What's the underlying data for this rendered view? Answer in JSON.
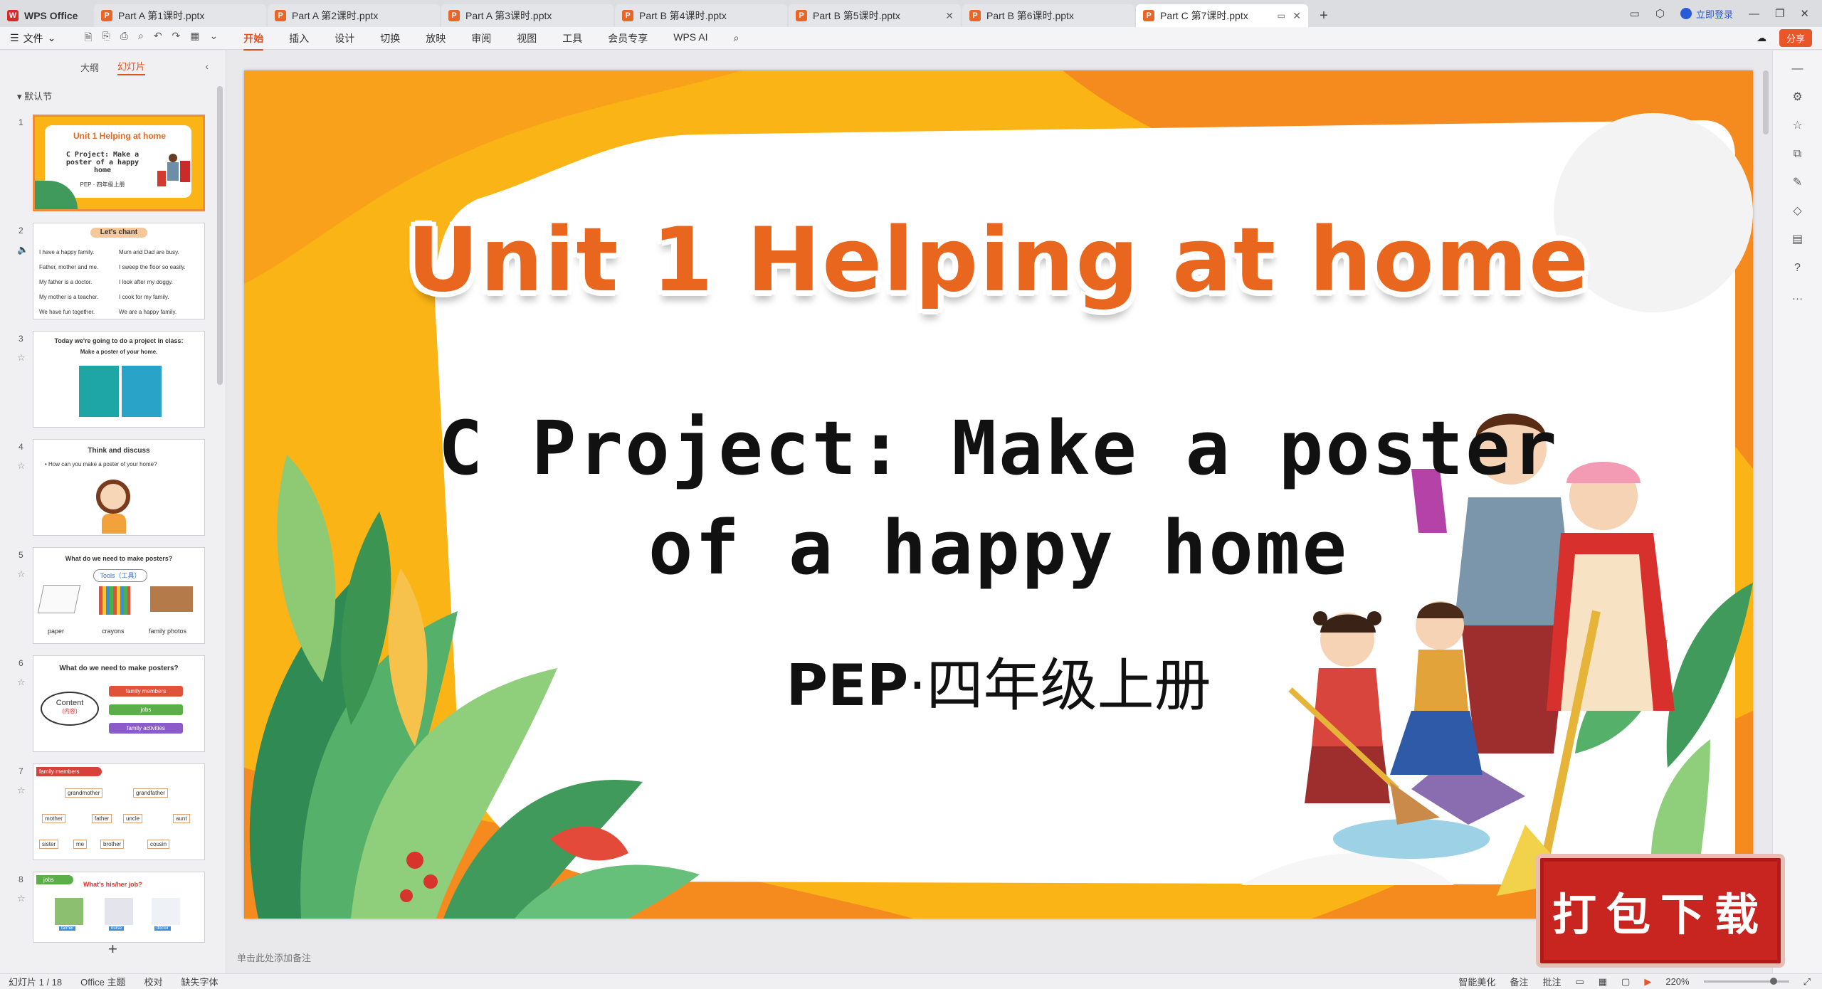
{
  "tabs": [
    {
      "label": "WPS Office",
      "home": true
    },
    {
      "label": "Part A 第1课时.pptx"
    },
    {
      "label": "Part A 第2课时.pptx"
    },
    {
      "label": "Part A 第3课时.pptx"
    },
    {
      "label": "Part B 第4课时.pptx"
    },
    {
      "label": "Part B 第5课时.pptx",
      "closable": true
    },
    {
      "label": "Part B 第6课时.pptx"
    },
    {
      "label": "Part C 第7课时.pptx",
      "active": true,
      "closable": true
    }
  ],
  "window": {
    "login": "立即登录"
  },
  "menubar": {
    "file": "文件",
    "items": [
      "开始",
      "插入",
      "设计",
      "切换",
      "放映",
      "审阅",
      "视图",
      "工具",
      "会员专享",
      "WPS AI"
    ],
    "active": "开始",
    "share": "分享"
  },
  "left_panel": {
    "tab_outline": "大纲",
    "tab_slides": "幻灯片",
    "section": "默认节",
    "slides": [
      {
        "num": "1",
        "title": "Unit 1 Helping at home",
        "sub": "C Project: Make a poster of a happy home",
        "foot": "PEP · 四年级上册"
      },
      {
        "num": "2",
        "title": "Let's chant",
        "lines": [
          "I have a happy family.",
          "Mum and Dad are busy.",
          "Father, mother and me.",
          "I sweep the floor so easily.",
          "My father is a doctor.",
          "I look after my doggy.",
          "My mother is a teacher.",
          "I cook for my family.",
          "We have fun together.",
          "We are a happy family."
        ]
      },
      {
        "num": "3",
        "title": "Today we're going to do a project in class:",
        "sub": "Make a poster of your home."
      },
      {
        "num": "4",
        "title": "Think and discuss",
        "sub": "How can you make a poster of your home?"
      },
      {
        "num": "5",
        "title": "What do we need to make posters?",
        "tools": "Tools（工具）",
        "items": [
          "paper",
          "crayons",
          "family photos"
        ]
      },
      {
        "num": "6",
        "title": "What do we need to make posters?",
        "content": "Content",
        "content_cn": "(内容)",
        "items": [
          "family members",
          "jobs",
          "family activities"
        ]
      },
      {
        "num": "7",
        "badge": "family members",
        "tree": [
          "grandmother",
          "grandfather",
          "mother",
          "father",
          "uncle",
          "aunt",
          "sister",
          "me",
          "brother",
          "cousin"
        ]
      },
      {
        "num": "8",
        "badge": "jobs",
        "title": "What's his/her job?",
        "items": [
          "farmer",
          "nurse",
          "doctor"
        ]
      }
    ]
  },
  "slide": {
    "title": "Unit 1 Helping at home",
    "line1": "C Project: Make a poster",
    "line2": "of a happy home",
    "pep": "PEP",
    "grade": "·四年级上册",
    "colors": {
      "orange": "#fbb416",
      "deep_orange": "#f58a1f",
      "title": "#e8661d",
      "leaf_green": "#3f9a5c"
    }
  },
  "notes_placeholder": "单击此处添加备注",
  "stamp": "打包下载",
  "statusbar": {
    "slide_count": "幻灯片 1 / 18",
    "theme": "Office 主题",
    "proof": "校对",
    "missing_font": "缺失字体",
    "smart": "智能美化",
    "notes": "备注",
    "comment": "批注",
    "zoom": "220%",
    "zoom_level": 0.85
  }
}
